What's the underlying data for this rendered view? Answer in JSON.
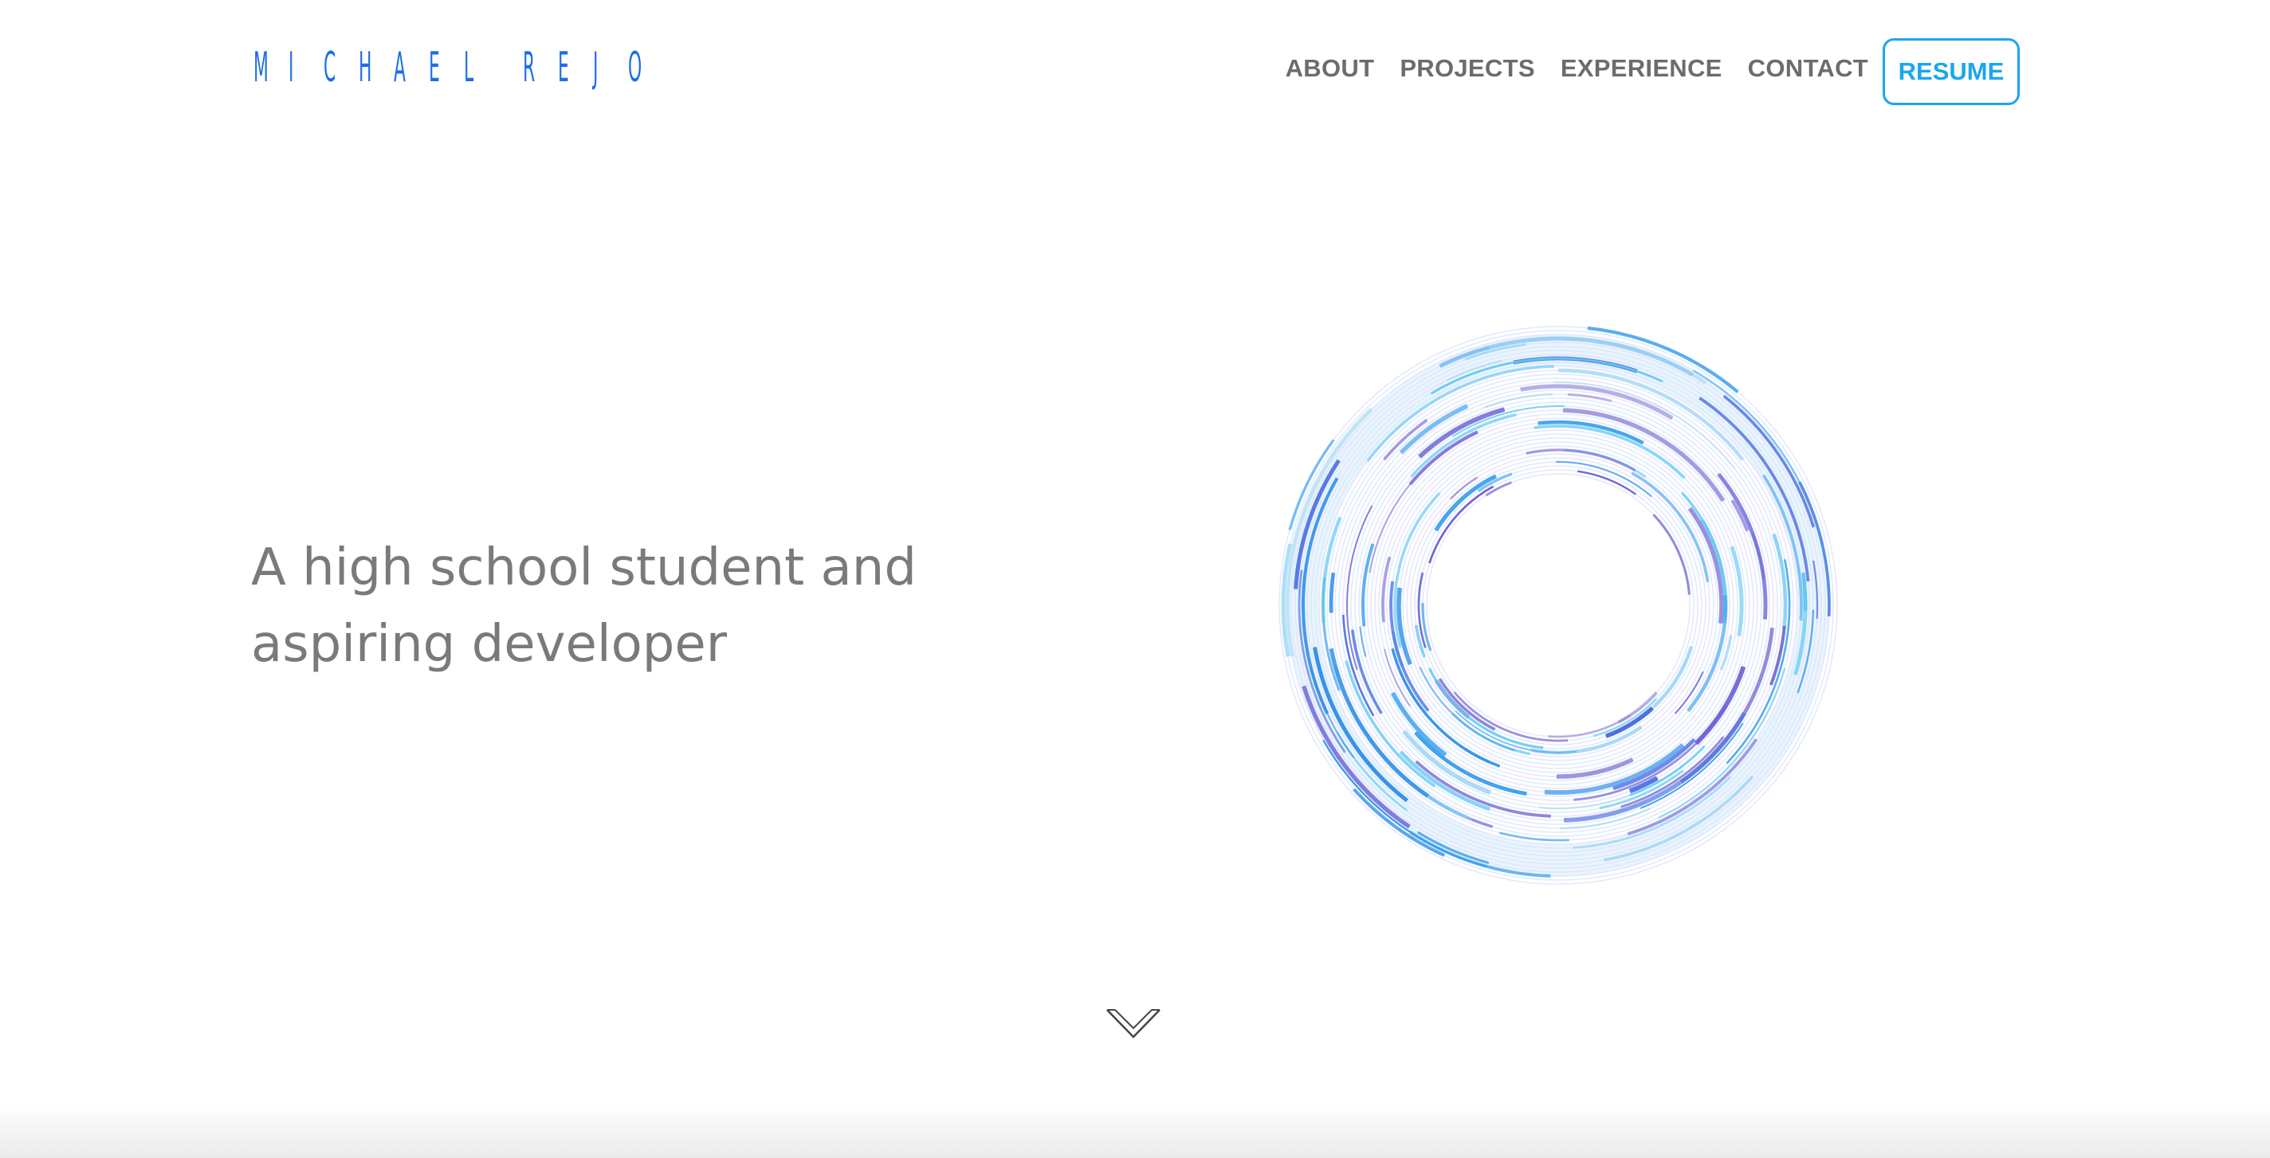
{
  "header": {
    "logo_letters": [
      "M",
      "I",
      "C",
      "H",
      "A",
      "E",
      "L",
      " ",
      "R",
      "E",
      "J",
      "O"
    ],
    "logo_text": "MICHAEL REJO",
    "brand_color": "#1f6fe5",
    "nav": [
      {
        "label": "ABOUT"
      },
      {
        "label": "PROJECTS"
      },
      {
        "label": "EXPERIENCE"
      },
      {
        "label": "CONTACT"
      }
    ],
    "resume_label": "RESUME",
    "accent_color": "#1aa7ec"
  },
  "hero": {
    "line1": "A high school student and",
    "line2": "aspiring developer",
    "graphic": "concentric-rings-graphic"
  },
  "scroll": {
    "icon": "chevron-down-icon"
  }
}
